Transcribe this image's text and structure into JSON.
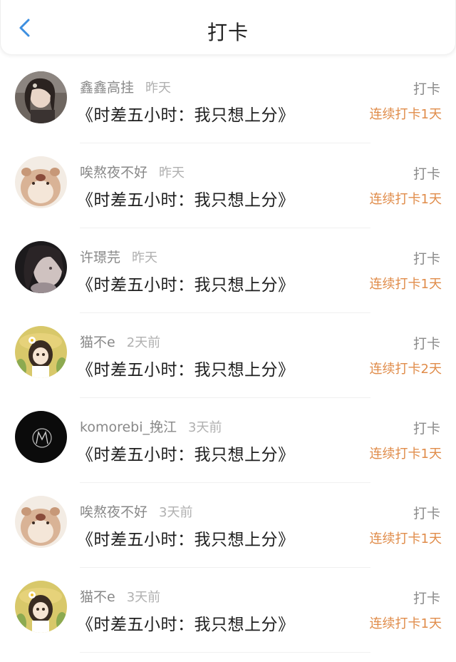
{
  "header": {
    "title": "打卡",
    "back_icon": "chevron-left-icon",
    "accent_color": "#3d8fe0"
  },
  "colors": {
    "streak": "#e08c4a",
    "name": "#888888",
    "time": "#b0b0b0"
  },
  "items": [
    {
      "user": "鑫鑫高挂",
      "time": "昨天",
      "book": "《时差五小时：我只想上分》",
      "action": "打卡",
      "streak": "连续打卡1天",
      "avatar": "avatar-girl-photo"
    },
    {
      "user": "唉熬夜不好",
      "time": "昨天",
      "book": "《时差五小时：我只想上分》",
      "action": "打卡",
      "streak": "连续打卡1天",
      "avatar": "avatar-hamster"
    },
    {
      "user": "许璟芫",
      "time": "昨天",
      "book": "《时差五小时：我只想上分》",
      "action": "打卡",
      "streak": "连续打卡1天",
      "avatar": "avatar-dark-portrait"
    },
    {
      "user": "猫不e",
      "time": "2天前",
      "book": "《时差五小时：我只想上分》",
      "action": "打卡",
      "streak": "连续打卡2天",
      "avatar": "avatar-anime-girl"
    },
    {
      "user": "komorebi_挽江",
      "time": "3天前",
      "book": "《时差五小时：我只想上分》",
      "action": "打卡",
      "streak": "连续打卡1天",
      "avatar": "avatar-black-m"
    },
    {
      "user": "唉熬夜不好",
      "time": "3天前",
      "book": "《时差五小时：我只想上分》",
      "action": "打卡",
      "streak": "连续打卡1天",
      "avatar": "avatar-hamster"
    },
    {
      "user": "猫不e",
      "time": "3天前",
      "book": "《时差五小时：我只想上分》",
      "action": "打卡",
      "streak": "连续打卡1天",
      "avatar": "avatar-anime-girl"
    }
  ]
}
